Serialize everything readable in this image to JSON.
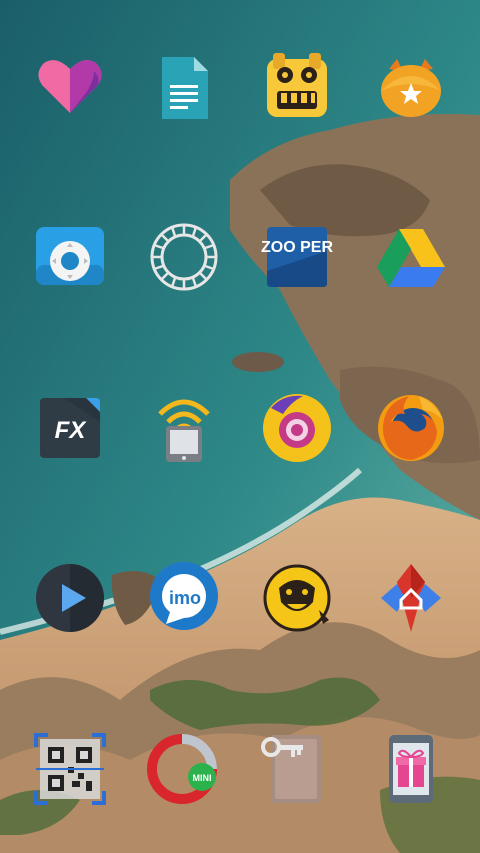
{
  "screen": {
    "type": "android-home-screen"
  },
  "wallpaper": {
    "description_icon": "beach-coastline-wallpaper"
  },
  "rows": [
    [
      {
        "name": "heart-app-icon",
        "icon": "pink-heart",
        "text": ""
      },
      {
        "name": "google-docs-icon",
        "icon": "document",
        "text": ""
      },
      {
        "name": "temple-run-icon",
        "icon": "tiki-mask",
        "text": ""
      },
      {
        "name": "mi-bunny-icon",
        "icon": "mi-bunny",
        "text": ""
      }
    ],
    [
      {
        "name": "remote-control-icon",
        "icon": "remote",
        "text": ""
      },
      {
        "name": "vsco-icon",
        "icon": "circle-ring",
        "text": ""
      },
      {
        "name": "zooper-widget-icon",
        "icon": "zooper",
        "text": "ZOO PER"
      },
      {
        "name": "google-drive-icon",
        "icon": "drive-triangle",
        "text": ""
      }
    ],
    [
      {
        "name": "fx-file-explorer-icon",
        "icon": "fx",
        "text": "FX"
      },
      {
        "name": "wifi-phone-icon",
        "icon": "wifi-phone",
        "text": ""
      },
      {
        "name": "camera-lens-icon",
        "icon": "yellow-camera",
        "text": ""
      },
      {
        "name": "firefox-icon",
        "icon": "firefox",
        "text": ""
      }
    ],
    [
      {
        "name": "video-player-icon",
        "icon": "play",
        "text": ""
      },
      {
        "name": "imo-messenger-icon",
        "icon": "imo-bubble",
        "text": "imo"
      },
      {
        "name": "gorilla-app-icon",
        "icon": "gorilla",
        "text": ""
      },
      {
        "name": "nova-launcher-icon",
        "icon": "nova",
        "text": ""
      }
    ],
    [
      {
        "name": "qr-scanner-icon",
        "icon": "qr",
        "text": ""
      },
      {
        "name": "opera-mini-icon",
        "icon": "opera-mini",
        "text": "MINI"
      },
      {
        "name": "key-door-icon",
        "icon": "key-door",
        "text": ""
      },
      {
        "name": "gift-phone-icon",
        "icon": "gift-phone",
        "text": ""
      }
    ]
  ],
  "colors": {
    "sea_deep": "#16606b",
    "sea_shallow": "#2f8c8a",
    "sand": "#c89a6e",
    "rock": "#8a7258",
    "vegetation": "#4f6b3a",
    "accent_yellow": "#f5c518"
  }
}
